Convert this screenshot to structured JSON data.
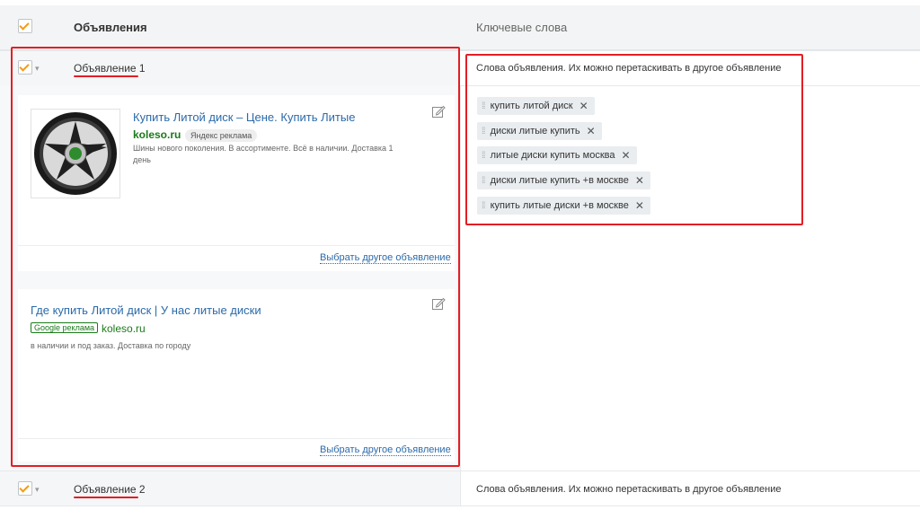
{
  "header": {
    "col_ads": "Объявления",
    "col_keywords": "Ключевые слова"
  },
  "groups": [
    {
      "title": "Объявление 1",
      "keywords_hint": "Слова объявления. Их можно перетаскивать в другое объявление",
      "ads": [
        {
          "title": "Купить Литой диск – Цене. Купить Литые",
          "domain": "koleso.ru",
          "badge": "Яндекс реклама",
          "desc_line1": "Шины нового поколения. В ассортименте. Всё в наличии. Доставка 1",
          "desc_line2": "день",
          "choose_label": "Выбрать другое объявление"
        },
        {
          "title": "Где купить Литой диск | У нас литые диски",
          "domain": "koleso.ru",
          "badge": "Google реклама",
          "desc_line1": "в наличии и под заказ. Доставка по городу",
          "choose_label": "Выбрать другое объявление"
        }
      ],
      "keywords": [
        "купить литой диск",
        "диски литые купить",
        "литые диски купить москва",
        "диски литые купить +в москве",
        "купить литые диски +в москве"
      ]
    },
    {
      "title": "Объявление 2",
      "keywords_hint": "Слова объявления. Их можно перетаскивать в другое объявление"
    }
  ],
  "icons": {
    "checkbox": "checkbox-checked-icon",
    "caret": "caret-down-icon",
    "edit": "edit-icon",
    "grip": "drag-handle-icon",
    "remove": "remove-icon"
  },
  "colors": {
    "accent_check": "#f39c12",
    "highlight": "#e31e24",
    "link": "#2b6aa9",
    "domain": "#1a7a1a"
  }
}
